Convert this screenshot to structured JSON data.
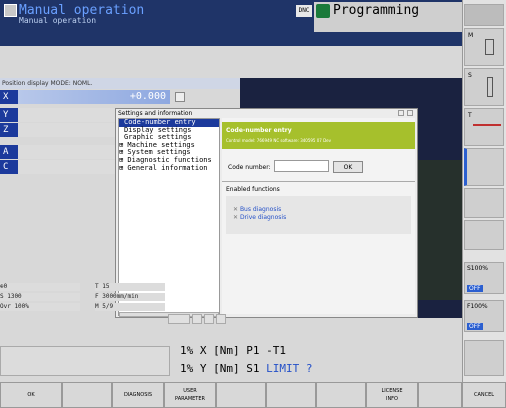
{
  "header": {
    "mode_title": "Manual operation",
    "mode_subtitle": "Manual operation",
    "dnc_badge": "DNC",
    "programming_title": "Programming"
  },
  "position_display": {
    "label": "Position display MODE: NOML.",
    "axes": [
      {
        "label": "X",
        "value": "+0.000"
      },
      {
        "label": "Y",
        "value": ""
      },
      {
        "label": "Z",
        "value": ""
      },
      {
        "label": "A",
        "value": ""
      },
      {
        "label": "C",
        "value": ""
      }
    ]
  },
  "dialog": {
    "title": "Settings and information",
    "tree": [
      "Code-number entry",
      "Display settings",
      "Graphic settings",
      "⊞ Machine settings",
      "⊞ System settings",
      "⊞ Diagnostic functions",
      "⊞ General information"
    ],
    "panel_title": "Code-number entry",
    "panel_info": "Control model: 766949        NC software: 340595 07 Dev",
    "code_label": "Code number:",
    "code_value": "",
    "ok_label": "OK",
    "enabled_functions_title": "Enabled functions",
    "functions": [
      "Bus diagnosis",
      "Drive diagnosis"
    ]
  },
  "status": {
    "tool_left": "0",
    "tool_right": "T 15",
    "spindle_left": "S 1300",
    "feed": "F 3000mm/min",
    "ovr": "Ovr 100%",
    "m": "M 5/9",
    "line1": "1% X [Nm]  P1  -T1",
    "line2_a": "1% Y [Nm]  S1",
    "line2_b": "LIMIT ?"
  },
  "right_bar": {
    "labels": [
      "M",
      "S",
      "T",
      "S100%",
      "OFF",
      "F100%",
      "OFF"
    ]
  },
  "softkeys": [
    "OK",
    "",
    "DIAGNOSIS",
    "USER\nPARAMETER",
    "",
    "",
    "",
    "LICENSE\nINFO",
    "",
    "CANCEL"
  ],
  "colors": {
    "header_bg": "#1f3468",
    "accent_green": "#a6c02c",
    "selected": "#1c3a9c",
    "limit": "#2450c8"
  }
}
